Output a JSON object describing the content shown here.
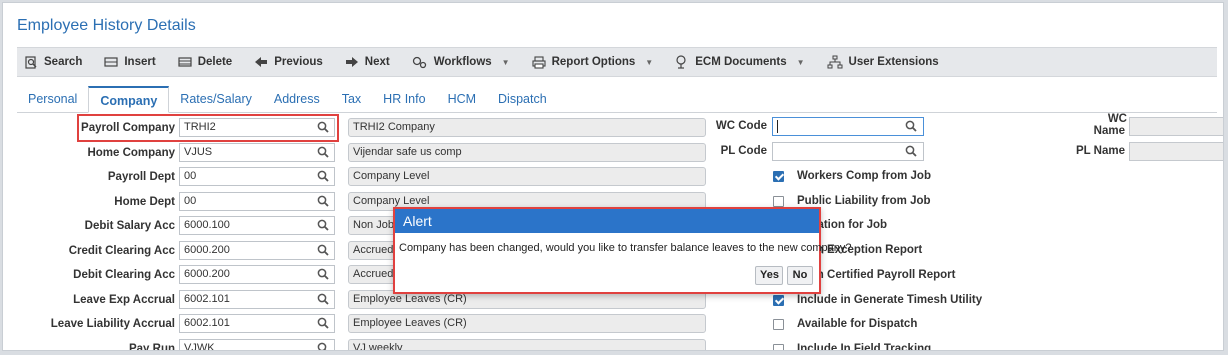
{
  "page": {
    "title": "Employee History Details"
  },
  "toolbar": [
    {
      "label": "Search",
      "icon": "search-icon"
    },
    {
      "label": "Insert",
      "icon": "insert-icon"
    },
    {
      "label": "Delete",
      "icon": "delete-icon"
    },
    {
      "label": "Previous",
      "icon": "arrow-left-icon"
    },
    {
      "label": "Next",
      "icon": "arrow-right-icon"
    },
    {
      "label": "Workflows",
      "icon": "workflow-icon",
      "dropdown": true
    },
    {
      "label": "Report Options",
      "icon": "print-icon",
      "dropdown": true
    },
    {
      "label": "ECM Documents",
      "icon": "ecm-icon",
      "dropdown": true
    },
    {
      "label": "User Extensions",
      "icon": "hierarchy-icon"
    }
  ],
  "tabs": [
    "Personal",
    "Company",
    "Rates/Salary",
    "Address",
    "Tax",
    "HR Info",
    "HCM",
    "Dispatch"
  ],
  "active_tab": "Company",
  "fields": [
    {
      "label": "Payroll Company",
      "value": "TRHI2",
      "desc": "TRHI2 Company"
    },
    {
      "label": "Home Company",
      "value": "VJUS",
      "desc": "Vijendar safe us comp"
    },
    {
      "label": "Payroll Dept",
      "value": "00",
      "desc": "Company Level"
    },
    {
      "label": "Home Dept",
      "value": "00",
      "desc": "Company Level"
    },
    {
      "label": "Debit Salary Acc",
      "value": "6000.100",
      "desc": "Non Job"
    },
    {
      "label": "Credit Clearing Acc",
      "value": "6000.200",
      "desc": "Accrued"
    },
    {
      "label": "Debit Clearing Acc",
      "value": "6000.200",
      "desc": "Accrued"
    },
    {
      "label": "Leave Exp Accrual",
      "value": "6002.101",
      "desc": "Employee Leaves (CR)"
    },
    {
      "label": "Leave Liability Accrual",
      "value": "6002.101",
      "desc": "Employee Leaves (CR)"
    },
    {
      "label": "Pay Run",
      "value": "VJWK",
      "desc": "VJ weekly"
    }
  ],
  "codes": {
    "wc_label": "WC Code",
    "wc_value": "",
    "pl_label": "PL Code",
    "pl_value": "",
    "wc_name_label_1": "WC",
    "wc_name_label_2": "Name",
    "pl_name_label": "PL Name"
  },
  "checkboxes": [
    {
      "label": "Workers Comp from Job",
      "checked": true
    },
    {
      "label": "Public Liability from Job",
      "checked": false
    },
    {
      "label": "Location for Job",
      "checked": false
    },
    {
      "label": "de in Exception Report",
      "checked": false
    },
    {
      "label": "de in Certified Payroll Report",
      "checked": false
    },
    {
      "label": "Include in Generate Timesh Utility",
      "checked": true
    },
    {
      "label": "Available for Dispatch",
      "checked": false
    },
    {
      "label": "Include In Field Tracking",
      "checked": false
    }
  ],
  "dialog": {
    "title": "Alert",
    "message": "Company has been changed, would you like to transfer balance leaves to the new company?",
    "yes": "Yes",
    "no": "No"
  },
  "colors": {
    "accent": "#2b6fb3",
    "dialog_header": "#2b74c9",
    "highlight": "#e0413f"
  }
}
